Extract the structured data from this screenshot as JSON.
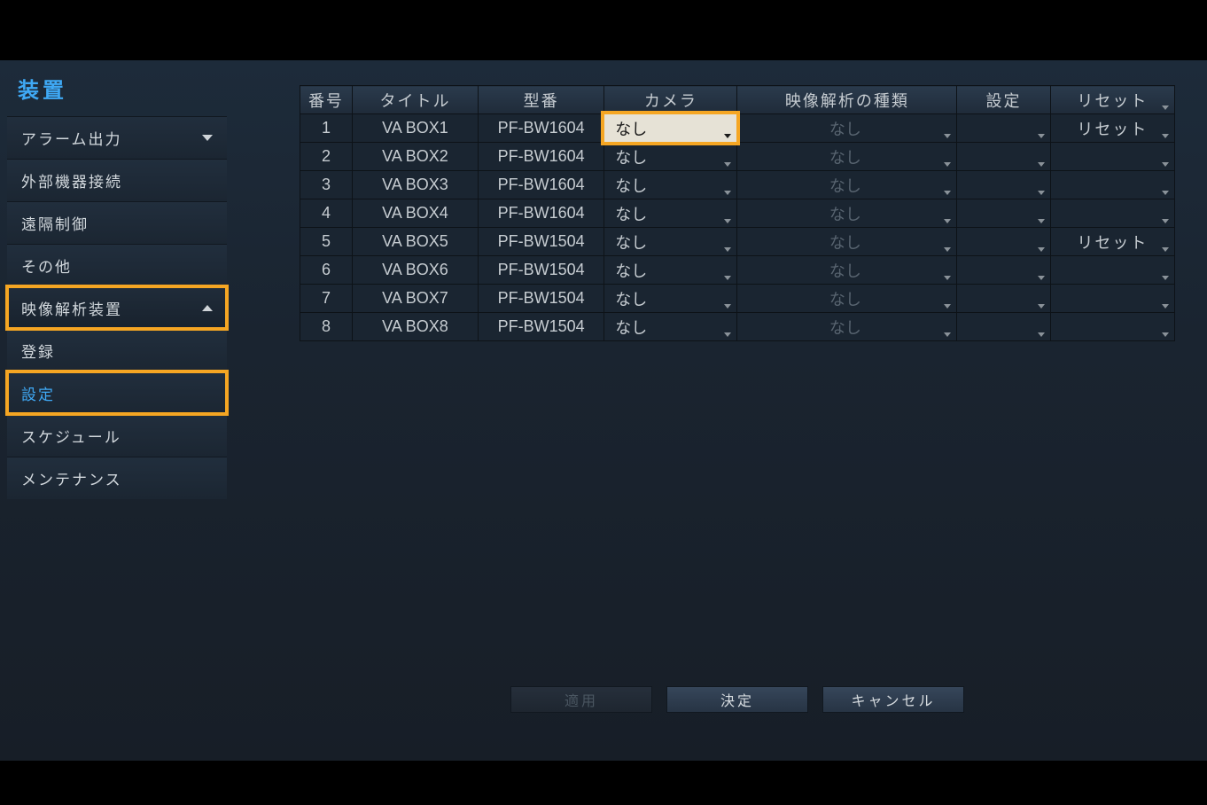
{
  "sidebar": {
    "title": "装置",
    "items": [
      {
        "label": "アラーム出力",
        "expandable": true,
        "expanded": false
      },
      {
        "label": "外部機器接続"
      },
      {
        "label": "遠隔制御"
      },
      {
        "label": "その他"
      },
      {
        "label": "映像解析装置",
        "expandable": true,
        "expanded": true,
        "highlighted": true
      },
      {
        "label": "登録",
        "sub": true
      },
      {
        "label": "設定",
        "sub": true,
        "selected": true,
        "highlighted": true
      },
      {
        "label": "スケジュール",
        "sub": true
      },
      {
        "label": "メンテナンス",
        "sub": true
      }
    ]
  },
  "table": {
    "headers": {
      "no": "番号",
      "title": "タイトル",
      "model": "型番",
      "camera": "カメラ",
      "type": "映像解析の種類",
      "settings": "設定",
      "reset": "リセット"
    },
    "rows": [
      {
        "no": "1",
        "title": "VA BOX1",
        "model": "PF-BW1604",
        "camera": "なし",
        "type": "なし",
        "reset": "リセット",
        "camera_active": true
      },
      {
        "no": "2",
        "title": "VA BOX2",
        "model": "PF-BW1604",
        "camera": "なし",
        "type": "なし",
        "reset": ""
      },
      {
        "no": "3",
        "title": "VA BOX3",
        "model": "PF-BW1604",
        "camera": "なし",
        "type": "なし",
        "reset": ""
      },
      {
        "no": "4",
        "title": "VA BOX4",
        "model": "PF-BW1604",
        "camera": "なし",
        "type": "なし",
        "reset": ""
      },
      {
        "no": "5",
        "title": "VA BOX5",
        "model": "PF-BW1504",
        "camera": "なし",
        "type": "なし",
        "reset": "リセット"
      },
      {
        "no": "6",
        "title": "VA BOX6",
        "model": "PF-BW1504",
        "camera": "なし",
        "type": "なし",
        "reset": ""
      },
      {
        "no": "7",
        "title": "VA BOX7",
        "model": "PF-BW1504",
        "camera": "なし",
        "type": "なし",
        "reset": ""
      },
      {
        "no": "8",
        "title": "VA BOX8",
        "model": "PF-BW1504",
        "camera": "なし",
        "type": "なし",
        "reset": ""
      }
    ]
  },
  "footer": {
    "apply": "適用",
    "ok": "決定",
    "cancel": "キャンセル"
  }
}
